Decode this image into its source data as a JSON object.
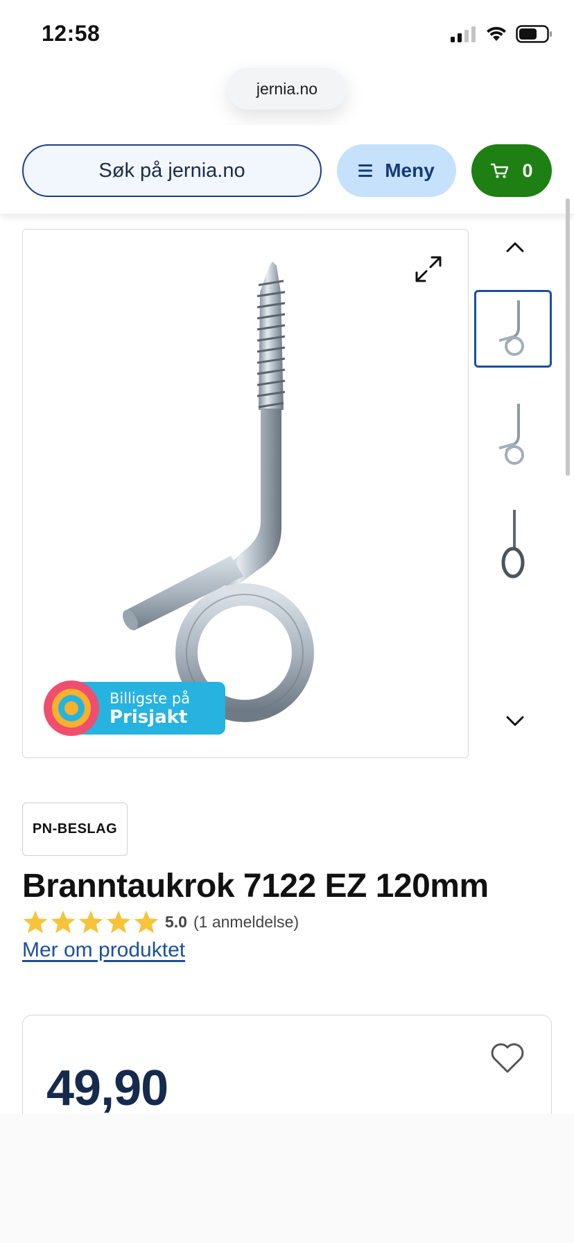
{
  "status_bar": {
    "time": "12:58",
    "signal_icon": "cellular-signal-icon",
    "wifi_icon": "wifi-icon",
    "battery_icon": "battery-icon"
  },
  "browser": {
    "url": "jernia.no"
  },
  "header": {
    "search_placeholder": "Søk på jernia.no",
    "menu_label": "Meny",
    "menu_icon": "hamburger-icon",
    "cart_icon": "cart-icon",
    "cart_count": "0",
    "colors": {
      "search_border": "#1b3a8c",
      "menu_bg": "#c6e1fb",
      "cart_bg": "#1e7f12"
    }
  },
  "gallery": {
    "expand_icon": "expand-icon",
    "thumbnail_count": 3,
    "active_thumbnail": 1,
    "badge": {
      "line1": "Billigste på",
      "line2": "Prisjakt"
    }
  },
  "product": {
    "brand": "PN-BESLAG",
    "title": "Branntaukrok 7122 EZ 120mm",
    "rating": {
      "stars": 5,
      "value": "5.0",
      "count_text": "(1 anmeldelse)"
    },
    "more_link": "Mer om produktet"
  },
  "price_card": {
    "price": "49,90",
    "favorite_icon": "heart-icon"
  }
}
